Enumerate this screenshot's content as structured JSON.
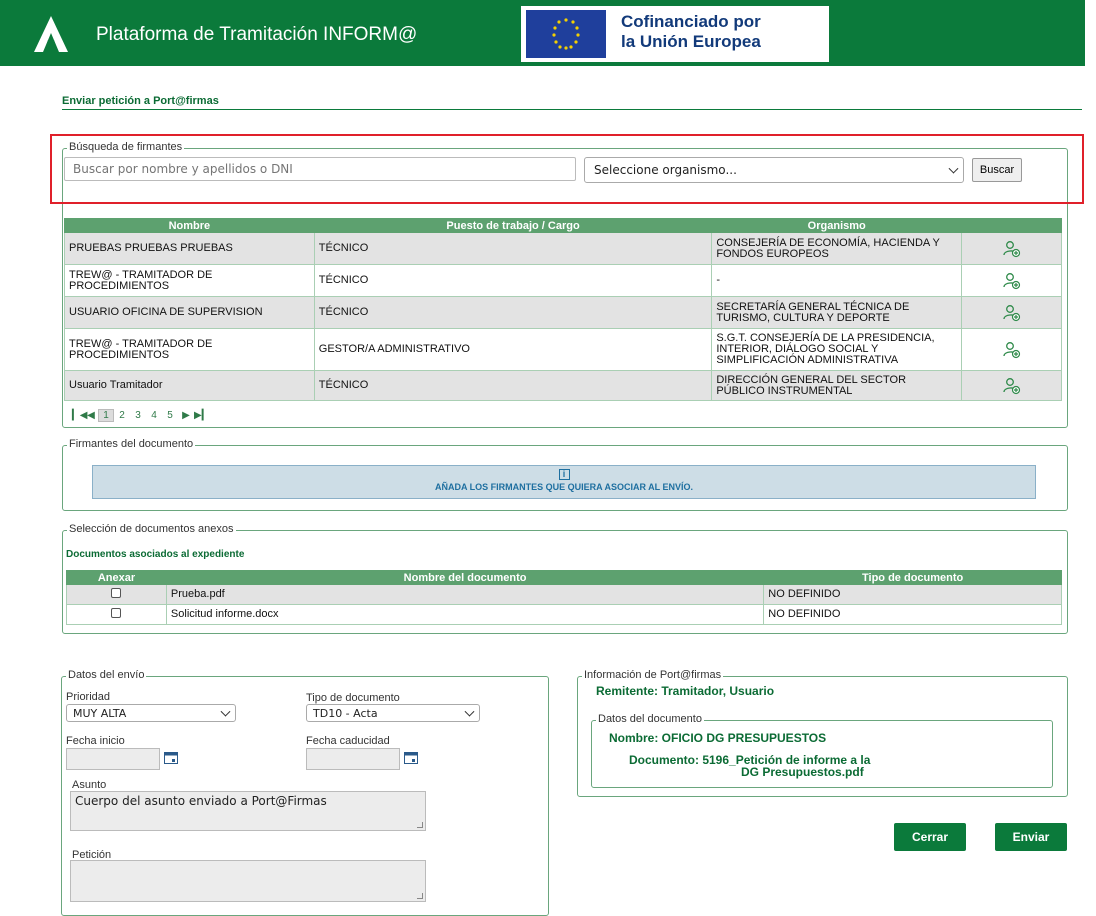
{
  "header": {
    "title": "Plataforma de Tramitación INFORM@",
    "eu_line1": "Cofinanciado por",
    "eu_line2": "la Unión Europea",
    "color": "#0b7a3b"
  },
  "page_title": "Enviar petición a Port@firmas",
  "busqueda": {
    "legend": "Búsqueda de firmantes",
    "search_placeholder": "Buscar por nombre y apellidos o DNI",
    "organismo_value": "Seleccione organismo...",
    "buscar_label": "Buscar",
    "headers": [
      "Nombre",
      "Puesto de trabajo / Cargo",
      "Organismo"
    ],
    "rows": [
      {
        "nombre": "PRUEBAS PRUEBAS PRUEBAS",
        "puesto": "TÉCNICO",
        "organismo": "CONSEJERÍA DE ECONOMÍA, HACIENDA Y FONDOS EUROPEOS"
      },
      {
        "nombre": "TREW@ - TRAMITADOR DE PROCEDIMIENTOS",
        "puesto": "TÉCNICO",
        "organismo": "-"
      },
      {
        "nombre": "USUARIO OFICINA DE SUPERVISION",
        "puesto": "TÉCNICO",
        "organismo": "SECRETARÍA GENERAL TÉCNICA DE TURISMO, CULTURA Y DEPORTE"
      },
      {
        "nombre": "TREW@ - TRAMITADOR DE PROCEDIMIENTOS",
        "puesto": "GESTOR/A ADMINISTRATIVO",
        "organismo": "S.G.T. CONSEJERÍA DE LA PRESIDENCIA, INTERIOR, DIÁLOGO SOCIAL Y SIMPLIFICACIÓN ADMINISTRATIVA"
      },
      {
        "nombre": "Usuario Tramitador",
        "puesto": "TÉCNICO",
        "organismo": "DIRECCIÓN GENERAL DEL SECTOR PÚBLICO INSTRUMENTAL"
      }
    ],
    "pages": [
      "1",
      "2",
      "3",
      "4",
      "5"
    ],
    "current_page": "1"
  },
  "firmantes": {
    "legend": "Firmantes del documento",
    "info_icon": "i",
    "info_text": "AÑADA LOS FIRMANTES QUE QUIERA ASOCIAR AL ENVÍO."
  },
  "anexos": {
    "legend": "Selección de documentos anexos",
    "subtitle": "Documentos asociados al expediente",
    "headers": [
      "Anexar",
      "Nombre del documento",
      "Tipo de documento"
    ],
    "rows": [
      {
        "nombre": "Prueba.pdf",
        "tipo": "NO DEFINIDO"
      },
      {
        "nombre": "Solicitud informe.docx",
        "tipo": "NO DEFINIDO"
      }
    ]
  },
  "envio": {
    "legend": "Datos del envío",
    "prioridad_label": "Prioridad",
    "prioridad_value": "MUY ALTA",
    "tipo_label": "Tipo de documento",
    "tipo_value": "TD10 - Acta",
    "fecha_inicio_label": "Fecha inicio",
    "fecha_caducidad_label": "Fecha caducidad",
    "asunto_label": "Asunto",
    "asunto_value": "Cuerpo del asunto enviado a Port@Firmas",
    "peticion_label": "Petición"
  },
  "info_portafirmas": {
    "legend": "Información de Port@firmas",
    "remitente": "Remitente: Tramitador, Usuario",
    "datos_legend": "Datos del documento",
    "nombre": "Nombre: OFICIO DG PRESUPUESTOS",
    "documento_line1": "Documento: 5196_Petición de informe a la",
    "documento_line2": "DG Presupuestos.pdf"
  },
  "buttons": {
    "cerrar": "Cerrar",
    "enviar": "Enviar"
  }
}
